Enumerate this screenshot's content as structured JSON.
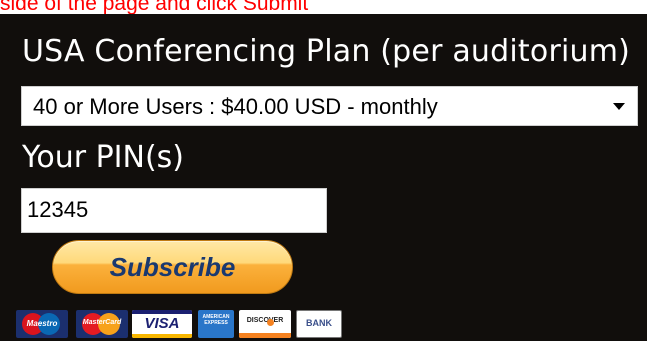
{
  "top_note": "side of the page and click Submit",
  "plan": {
    "label": "USA Conferencing Plan (per auditorium)",
    "selected": "40 or More Users : $40.00 USD - monthly"
  },
  "pin": {
    "label": "Your PIN(s)",
    "value": "12345"
  },
  "subscribe_label": "Subscribe",
  "payment_icons": [
    "maestro-icon",
    "mastercard-icon",
    "visa-icon",
    "amex-icon",
    "discover-icon",
    "bank-icon"
  ],
  "card_text": {
    "maestro": "Maestro",
    "mastercard": "MasterCard",
    "visa": "VISA",
    "amex": "AMERICAN EXPRESS",
    "discover": "DISCOVER",
    "bank": "BANK"
  },
  "colors": {
    "panel_bg": "#110e0c",
    "note": "#ff0000",
    "button": "#f9a82a",
    "button_text": "#1a3970"
  }
}
